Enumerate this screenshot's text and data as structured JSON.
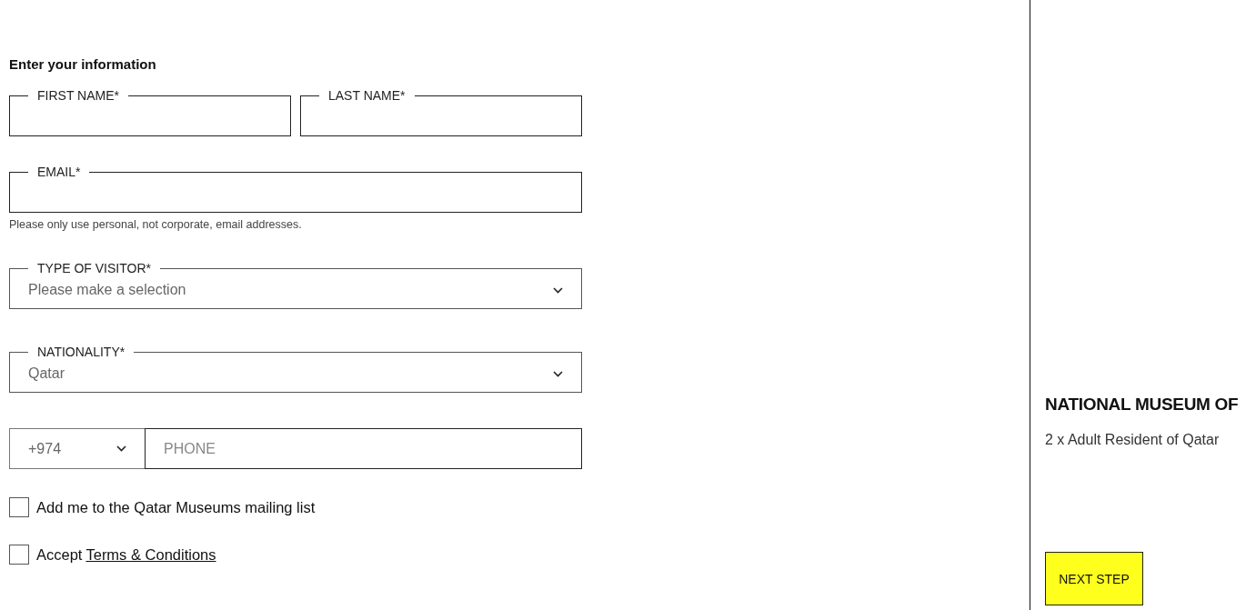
{
  "form": {
    "heading": "Enter your information",
    "fields": [
      {
        "kind": "pair",
        "items": [
          {
            "label": "FIRST NAME*"
          },
          {
            "label": "LAST NAME*"
          }
        ]
      },
      {
        "kind": "text",
        "label": "EMAIL*",
        "hint": "Please only use personal, not corporate, email addresses."
      },
      {
        "kind": "select",
        "label": "TYPE OF VISITOR*",
        "placeholder": "Please make a selection"
      },
      {
        "kind": "select",
        "label": "NATIONALITY*",
        "value": "Qatar"
      },
      {
        "kind": "phone",
        "code": "+974",
        "placeholder": "PHONE"
      }
    ],
    "checkboxes": [
      {
        "label": "Add me to the Qatar Museums mailing list",
        "checked": false
      },
      {
        "label": "Accept",
        "link": "Terms & Conditions",
        "checked": false
      }
    ]
  },
  "summary": {
    "title": "NATIONAL MUSEUM OF",
    "ticket": "2 x Adult Resident of Qatar",
    "button": "NEXT STEP"
  }
}
